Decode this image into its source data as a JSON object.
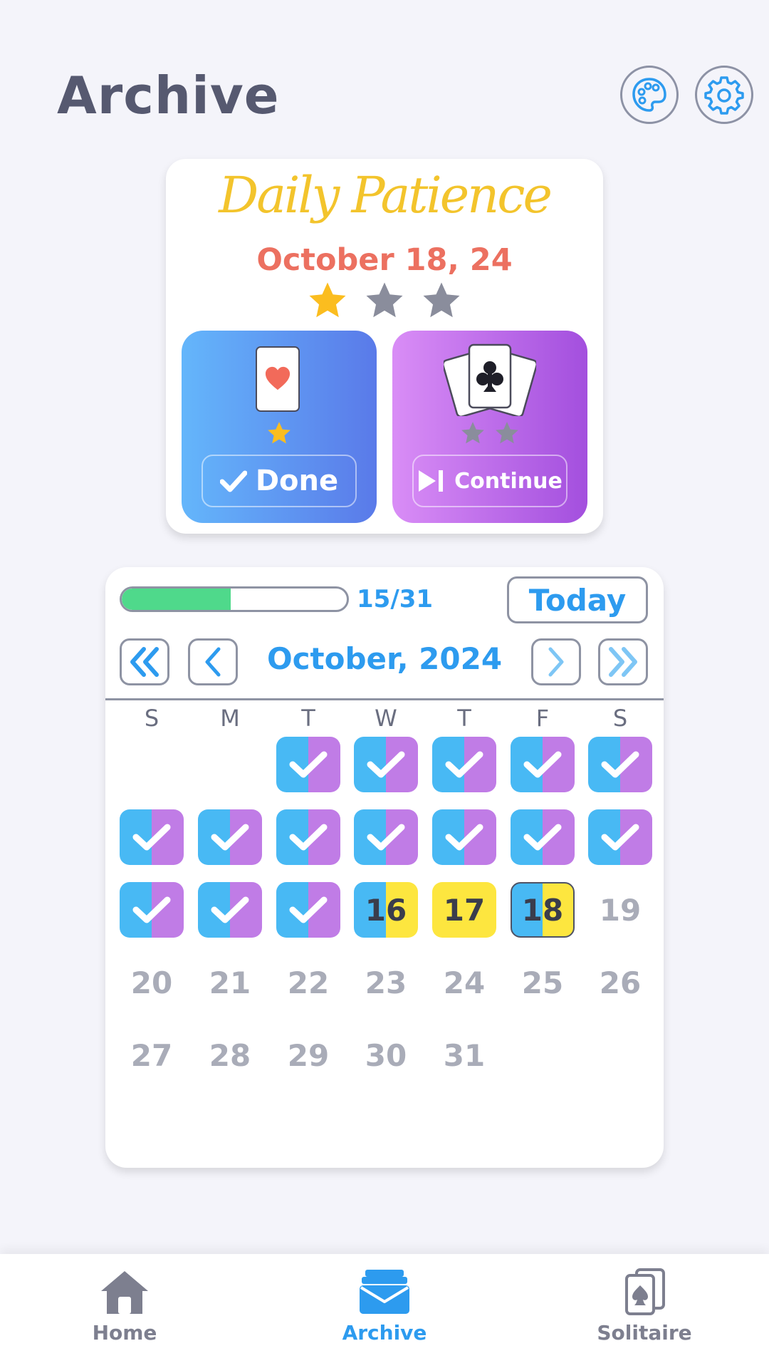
{
  "header": {
    "title": "Archive",
    "palette_icon": "palette-icon",
    "settings_icon": "gear-icon"
  },
  "daily": {
    "heading": "Daily Patience",
    "date": "October 18, 24",
    "stars_earned": 1,
    "stars_total": 3,
    "modes": [
      {
        "name": "classic",
        "card_suit": "heart",
        "stars_earned": 1,
        "stars_total": 1,
        "button_label": "Done",
        "button_icon": "check-icon"
      },
      {
        "name": "double",
        "card_suit": "club",
        "stars_earned": 0,
        "stars_total": 2,
        "button_label": "Continue",
        "button_icon": "play-next-icon"
      }
    ]
  },
  "calendar": {
    "progress_done": 15,
    "progress_total": 31,
    "progress_text": "15/31",
    "today_label": "Today",
    "month_label": "October, 2024",
    "weekdays": [
      "S",
      "M",
      "T",
      "W",
      "T",
      "F",
      "S"
    ],
    "first_weekday": 2,
    "days_in_month": 31,
    "current_day": 18,
    "day_status": {
      "1": "done",
      "2": "done",
      "3": "done",
      "4": "done",
      "5": "done",
      "6": "done",
      "7": "done",
      "8": "done",
      "9": "done",
      "10": "done",
      "11": "done",
      "12": "done",
      "13": "done",
      "14": "done",
      "15": "done",
      "16": "half",
      "17": "won",
      "18": "half"
    }
  },
  "bottom_nav": {
    "items": [
      {
        "label": "Home",
        "icon": "home-icon",
        "active": false
      },
      {
        "label": "Archive",
        "icon": "archive-icon",
        "active": true
      },
      {
        "label": "Solitaire",
        "icon": "solitaire-cards-icon",
        "active": false
      }
    ]
  },
  "colors": {
    "title": "#565970",
    "accent_blue": "#2d9bef",
    "date_red": "#ec7060",
    "star_gold": "#fbbd1f",
    "star_gray": "#8a8d9c",
    "done_blue": "#48b9f4",
    "done_purple": "#c07ce6",
    "won_yellow": "#fde63f",
    "progress_green": "#4fd98b",
    "nav_inactive": "#7d7f8f"
  }
}
